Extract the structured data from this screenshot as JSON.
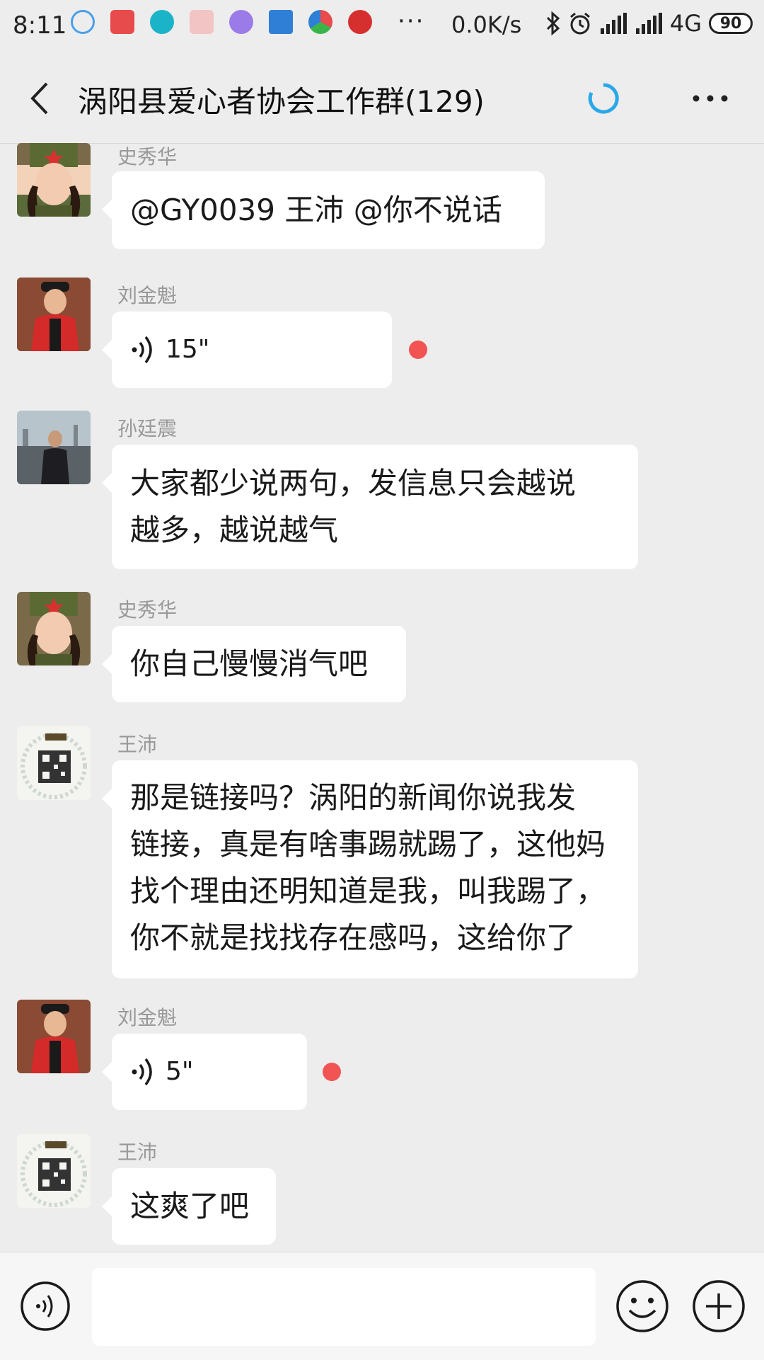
{
  "status_bar": {
    "time": "8:11",
    "network_speed": "0.0K/s",
    "network_type": "4G",
    "battery": "90"
  },
  "nav": {
    "title": "涡阳县爱心者协会工作群(129)"
  },
  "messages": [
    {
      "sender": "史秀华",
      "type": "text",
      "text": "@GY0039 王沛  @你不说话",
      "avatar": "soldier-avatar"
    },
    {
      "sender": "刘金魁",
      "type": "voice",
      "duration": "15\"",
      "unread": true,
      "avatar": "red-vest-avatar"
    },
    {
      "sender": "孙廷震",
      "type": "text",
      "lines": [
        "大家都少说两句，发信息只会越说",
        "越多，越说越气"
      ],
      "avatar": "river-photo-avatar"
    },
    {
      "sender": "史秀华",
      "type": "text",
      "text": "你自己慢慢消气吧",
      "avatar": "soldier-avatar"
    },
    {
      "sender": "王沛",
      "type": "text",
      "lines": [
        "那是链接吗？涡阳的新闻你说我发",
        "链接，真是有啥事踢就踢了，这他妈",
        "找个理由还明知道是我，叫我踢了，",
        "你不就是找找存在感吗，这给你了"
      ],
      "avatar": "qr-badge-avatar"
    },
    {
      "sender": "刘金魁",
      "type": "voice",
      "duration": "5\"",
      "unread": true,
      "avatar": "red-vest-avatar"
    },
    {
      "sender": "王沛",
      "type": "text",
      "text": "这爽了吧",
      "avatar": "qr-badge-avatar"
    }
  ],
  "colors": {
    "background": "#ededed",
    "bubble": "#ffffff",
    "unread_dot": "#f25454",
    "spinner": "#2aa8e8"
  }
}
